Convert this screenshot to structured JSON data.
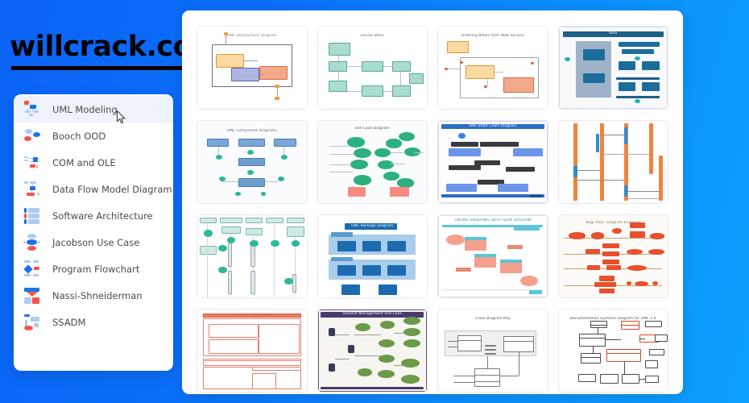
{
  "watermark": {
    "text": "willcrack.com"
  },
  "cursor": {
    "name": "mouse-pointer"
  },
  "sidebar": {
    "items": [
      {
        "label": "UML Modeling",
        "icon": "uml-modeling-icon",
        "active": true
      },
      {
        "label": "Booch OOD",
        "icon": "booch-ood-icon",
        "active": false
      },
      {
        "label": "COM and OLE",
        "icon": "com-and-ole-icon",
        "active": false
      },
      {
        "label": "Data Flow Model Diagram",
        "icon": "data-flow-model-icon",
        "active": false
      },
      {
        "label": "Software Architecture",
        "icon": "software-architecture-icon",
        "active": false
      },
      {
        "label": "Jacobson Use Case",
        "icon": "jacobson-use-case-icon",
        "active": false
      },
      {
        "label": "Program Flowchart",
        "icon": "program-flowchart-icon",
        "active": false
      },
      {
        "label": "Nassi-Shneiderman",
        "icon": "nassi-shneiderman-icon",
        "active": false
      },
      {
        "label": "SSADM",
        "icon": "ssadm-icon",
        "active": false
      }
    ]
  },
  "gallery": {
    "thumbnails": [
      {
        "id": "thumb-1",
        "title": "UML Deployment Diagram",
        "style": "deployment"
      },
      {
        "id": "thumb-2",
        "title": "Online Store",
        "style": "classgreen"
      },
      {
        "id": "thumb-3",
        "title": "Ordering Meals from Web Service",
        "style": "composite"
      },
      {
        "id": "thumb-4",
        "title": "SSIS",
        "style": "activityblue"
      },
      {
        "id": "thumb-5",
        "title": "UML Component Diagrams",
        "style": "component"
      },
      {
        "id": "thumb-6",
        "title": "Use Case Diagram",
        "style": "usecasegreen"
      },
      {
        "id": "thumb-7",
        "title": "UML State Chart Diagram",
        "style": "statechart"
      },
      {
        "id": "thumb-8",
        "title": "",
        "style": "sequenceorange"
      },
      {
        "id": "thumb-9",
        "title": "",
        "style": "sequenceteal"
      },
      {
        "id": "thumb-10",
        "title": "UML Package Diagram",
        "style": "package"
      },
      {
        "id": "thumb-11",
        "title": "ONLINE ORDERING DATA FLOW DIAGRAM",
        "style": "dataflowsalmon"
      },
      {
        "id": "thumb-12",
        "title": "Bilgi Akış ı Diagram Example",
        "style": "flowred"
      },
      {
        "id": "thumb-13",
        "title": "IT Cluster (symmetric)",
        "style": "nassi"
      },
      {
        "id": "thumb-14",
        "title": "Student Management Use Case",
        "style": "studentusecase"
      },
      {
        "id": "thumb-15",
        "title": "Class Diagram Key",
        "style": "classkey"
      },
      {
        "id": "thumb-16",
        "title": "Documentation Systems Diagram for UML 2.0",
        "style": "docsystem"
      }
    ]
  },
  "colors": {
    "bg_left": "#0a63f5",
    "bg_right": "#0d9efc",
    "panel_bg": "#ffffff",
    "sidebar_active": "#eef2fa",
    "icon_red": "#f5534d",
    "icon_blue": "#1a73e8",
    "icon_light_blue": "#aecbf0",
    "text": "#4a4a4a"
  }
}
